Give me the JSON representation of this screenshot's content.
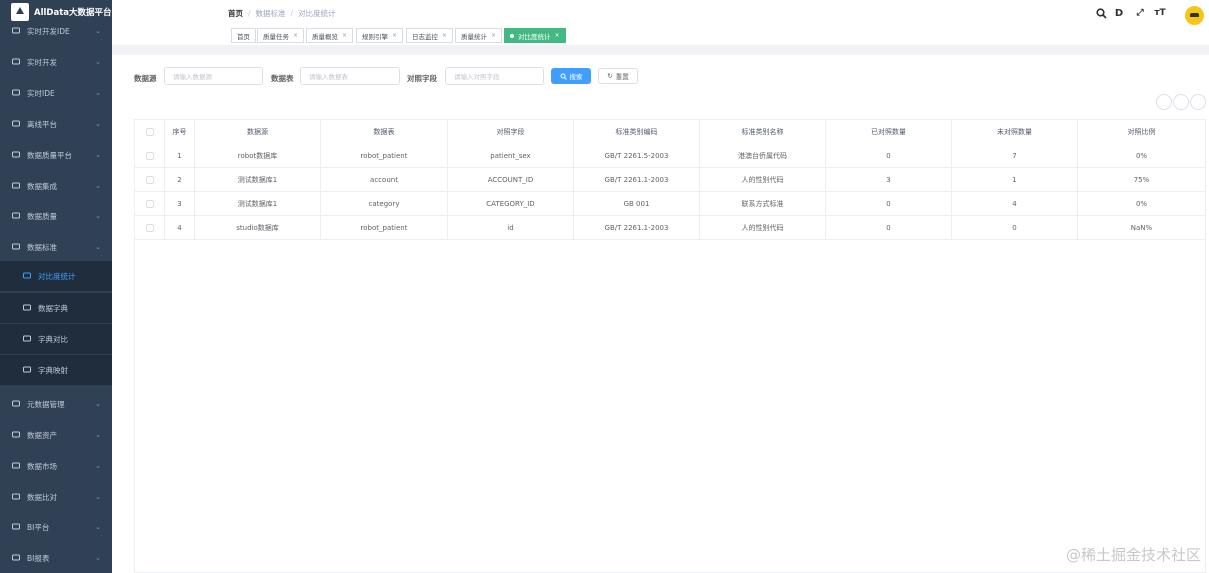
{
  "app": {
    "title": "AllData大数据平台"
  },
  "sidebar": {
    "items": [
      {
        "label": "实时开发IDE",
        "icon": "monitor-icon"
      },
      {
        "label": "实时开发",
        "icon": "monitor-icon"
      },
      {
        "label": "实时IDE",
        "icon": "send-icon"
      },
      {
        "label": "离线平台",
        "icon": "send-icon"
      },
      {
        "label": "数据质量平台",
        "icon": "user-icon"
      },
      {
        "label": "数据集成",
        "icon": "gear-icon"
      },
      {
        "label": "数据质量",
        "icon": "user-icon"
      },
      {
        "label": "数据标准",
        "icon": "send-icon"
      },
      {
        "label": "对比度统计",
        "icon": "gear-icon"
      },
      {
        "label": "数据字典",
        "icon": "gear-icon"
      },
      {
        "label": "字典对比",
        "icon": "eye-icon"
      },
      {
        "label": "字典映射",
        "icon": "user-icon"
      },
      {
        "label": "元数据管理",
        "icon": "send-icon"
      },
      {
        "label": "数据资产",
        "icon": "monitor-icon"
      },
      {
        "label": "数据市场",
        "icon": "table-icon"
      },
      {
        "label": "数据比对",
        "icon": "database-icon"
      },
      {
        "label": "BI平台",
        "icon": "bar-chart-icon"
      },
      {
        "label": "BI报表",
        "icon": "user-icon"
      }
    ]
  },
  "breadcrumb": {
    "home": "首页",
    "level1": "数据标准",
    "level2": "对比度统计",
    "sep": "/"
  },
  "toolbar": {
    "search": "Q",
    "doc": "D",
    "fullscreen": "⤢",
    "size": "тT"
  },
  "tags": [
    {
      "label": "首页",
      "closable": false
    },
    {
      "label": "质量任务",
      "closable": true
    },
    {
      "label": "质量概览",
      "closable": true
    },
    {
      "label": "规则引擎",
      "closable": true
    },
    {
      "label": "日志监控",
      "closable": true
    },
    {
      "label": "质量统计",
      "closable": true
    },
    {
      "label": "对比度统计",
      "closable": true,
      "active": true
    }
  ],
  "tag_close": "×",
  "search": {
    "datasource_label": "数据源",
    "datasource_placeholder": "请输入数据源",
    "table_label": "数据表",
    "table_placeholder": "请输入数据表",
    "field_label": "对照字段",
    "field_placeholder": "请输入对照字段",
    "search_button": "搜索",
    "reset_button": "重置"
  },
  "table": {
    "columns": [
      "序号",
      "数据源",
      "数据表",
      "对照字段",
      "标准类别编码",
      "标准类别名称",
      "已对照数量",
      "未对照数量",
      "对照比例"
    ],
    "rows": [
      [
        "1",
        "robot数据库",
        "robot_patient",
        "patient_sex",
        "GB/T 2261.5-2003",
        "港澳台侨属代码",
        "0",
        "7",
        "0%"
      ],
      [
        "2",
        "测试数据库1",
        "account",
        "ACCOUNT_ID",
        "GB/T 2261.1-2003",
        "人的性别代码",
        "3",
        "1",
        "75%"
      ],
      [
        "3",
        "测试数据库1",
        "category",
        "CATEGORY_ID",
        "GB 001",
        "联系方式标准",
        "0",
        "4",
        "0%"
      ],
      [
        "4",
        "studio数据库",
        "robot_patient",
        "id",
        "GB/T 2261.1-2003",
        "人的性别代码",
        "0",
        "0",
        "NaN%"
      ]
    ]
  },
  "watermark": "@稀土掘金技术社区"
}
